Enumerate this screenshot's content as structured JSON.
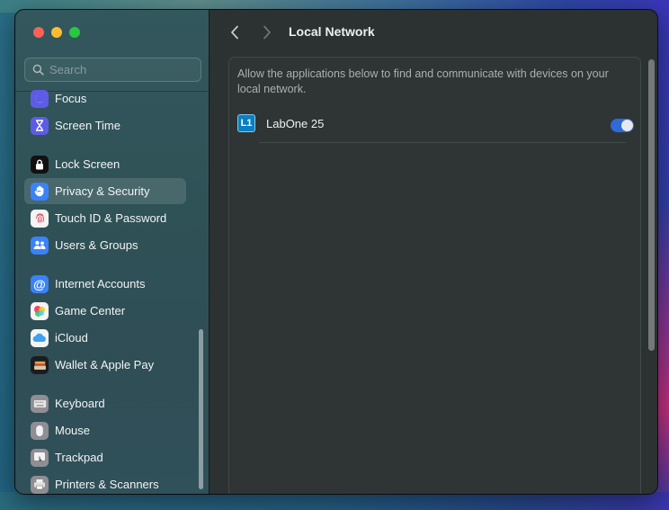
{
  "window": {
    "title": "Local Network"
  },
  "search": {
    "placeholder": "Search"
  },
  "sidebar": {
    "items": [
      {
        "label": "Focus",
        "icon": "moon-icon",
        "color": "#5e5ce6"
      },
      {
        "label": "Screen Time",
        "icon": "hourglass-icon",
        "color": "#5e5ce6"
      },
      {
        "label": "Lock Screen",
        "icon": "lock-icon",
        "color": "#1c1c1e"
      },
      {
        "label": "Privacy & Security",
        "icon": "hand-icon",
        "color": "#3a82f7",
        "selected": true
      },
      {
        "label": "Touch ID & Password",
        "icon": "fingerprint-icon",
        "color": "#f4f4f4"
      },
      {
        "label": "Users & Groups",
        "icon": "users-icon",
        "color": "#3a82f7"
      },
      {
        "label": "Internet Accounts",
        "icon": "at-icon",
        "color": "#3a82f7"
      },
      {
        "label": "Game Center",
        "icon": "game-center-icon",
        "color": "#f4f4f4"
      },
      {
        "label": "iCloud",
        "icon": "cloud-icon",
        "color": "#f4f4f4"
      },
      {
        "label": "Wallet & Apple Pay",
        "icon": "wallet-icon",
        "color": "#1c1c1e"
      },
      {
        "label": "Keyboard",
        "icon": "keyboard-icon",
        "color": "#8e8e93"
      },
      {
        "label": "Mouse",
        "icon": "mouse-icon",
        "color": "#8e8e93"
      },
      {
        "label": "Trackpad",
        "icon": "trackpad-icon",
        "color": "#8e8e93"
      },
      {
        "label": "Printers & Scanners",
        "icon": "printer-icon",
        "color": "#8e8e93"
      }
    ]
  },
  "main": {
    "description": "Allow the applications below to find and communicate with devices on your local network.",
    "apps": [
      {
        "name": "LabOne 25",
        "icon_text": "L1",
        "enabled": true
      }
    ]
  },
  "colors": {
    "accent": "#2e6bd8",
    "sidebar_bg": "#2f5257",
    "main_bg": "#2c3131"
  }
}
